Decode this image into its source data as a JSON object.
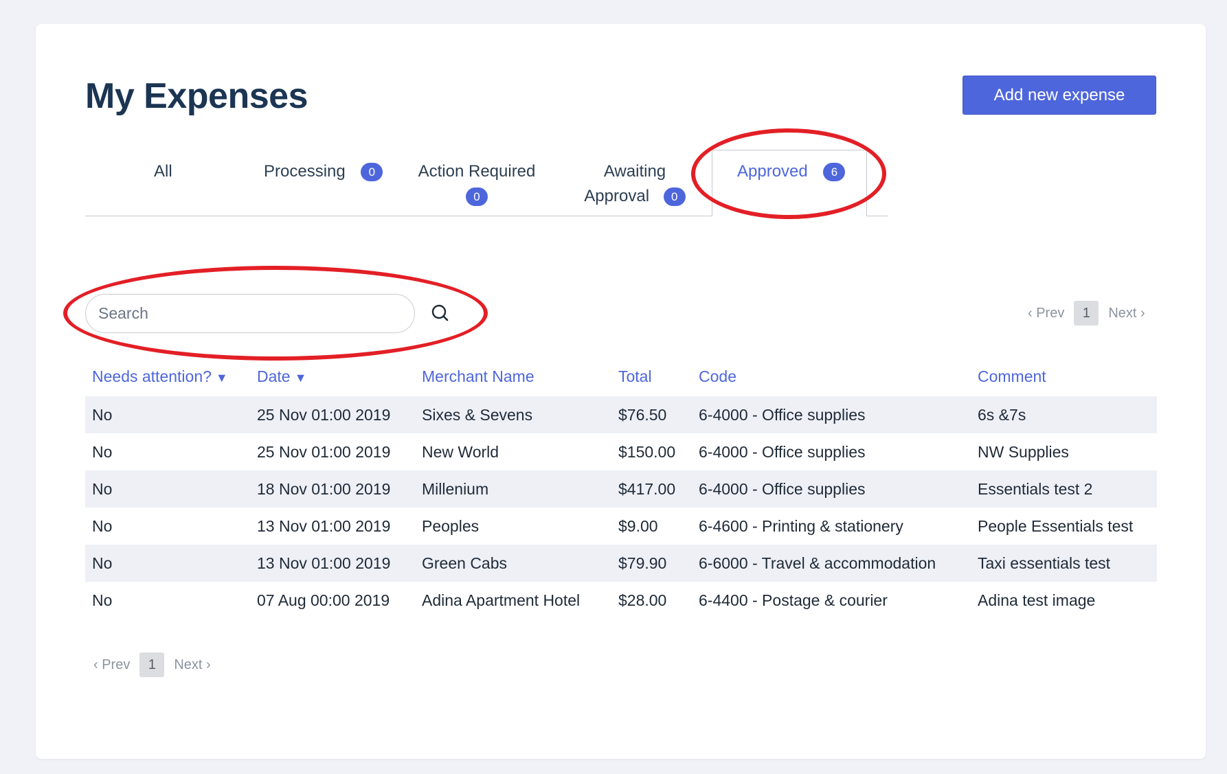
{
  "page": {
    "title": "My Expenses"
  },
  "actions": {
    "add_expense_label": "Add new expense"
  },
  "tabs": [
    {
      "label": "All",
      "count": null,
      "active": false
    },
    {
      "label": "Processing",
      "count": "0",
      "active": false
    },
    {
      "label": "Action Required",
      "count": "0",
      "active": false
    },
    {
      "label_line1": "Awaiting",
      "label_line2": "Approval",
      "count": "0",
      "active": false
    },
    {
      "label": "Approved",
      "count": "6",
      "active": true
    }
  ],
  "search": {
    "placeholder": "Search",
    "value": ""
  },
  "pager": {
    "prev_label": "‹ Prev",
    "current_page": "1",
    "next_label": "Next ›"
  },
  "table": {
    "columns": [
      {
        "label": "Needs attention?",
        "sort_icon": "▼"
      },
      {
        "label": "Date",
        "sort_icon": "▼"
      },
      {
        "label": "Merchant Name"
      },
      {
        "label": "Total"
      },
      {
        "label": "Code"
      },
      {
        "label": "Comment"
      }
    ],
    "rows": [
      {
        "needs_attention": "No",
        "date": "25 Nov 01:00 2019",
        "merchant": "Sixes & Sevens",
        "total": "$76.50",
        "code": "6-4000 - Office supplies",
        "comment": "6s &7s"
      },
      {
        "needs_attention": "No",
        "date": "25 Nov 01:00 2019",
        "merchant": "New World",
        "total": "$150.00",
        "code": "6-4000 - Office supplies",
        "comment": "NW Supplies"
      },
      {
        "needs_attention": "No",
        "date": "18 Nov 01:00 2019",
        "merchant": "Millenium",
        "total": "$417.00",
        "code": "6-4000 - Office supplies",
        "comment": "Essentials test 2"
      },
      {
        "needs_attention": "No",
        "date": "13 Nov 01:00 2019",
        "merchant": "Peoples",
        "total": "$9.00",
        "code": "6-4600 - Printing & stationery",
        "comment": "People Essentials test"
      },
      {
        "needs_attention": "No",
        "date": "13 Nov 01:00 2019",
        "merchant": "Green Cabs",
        "total": "$79.90",
        "code": "6-6000 - Travel & accommodation",
        "comment": "Taxi essentials test"
      },
      {
        "needs_attention": "No",
        "date": "07 Aug 00:00 2019",
        "merchant": "Adina Apartment Hotel",
        "total": "$28.00",
        "code": "6-4400 - Postage & courier",
        "comment": "Adina test image"
      }
    ]
  },
  "icons": {
    "search": "search-icon",
    "sort": "sort-down-icon"
  },
  "colors": {
    "accent": "#4e66db",
    "title": "#1b3553",
    "annotation": "#e31f26",
    "row_stripe": "#eef0f6"
  }
}
